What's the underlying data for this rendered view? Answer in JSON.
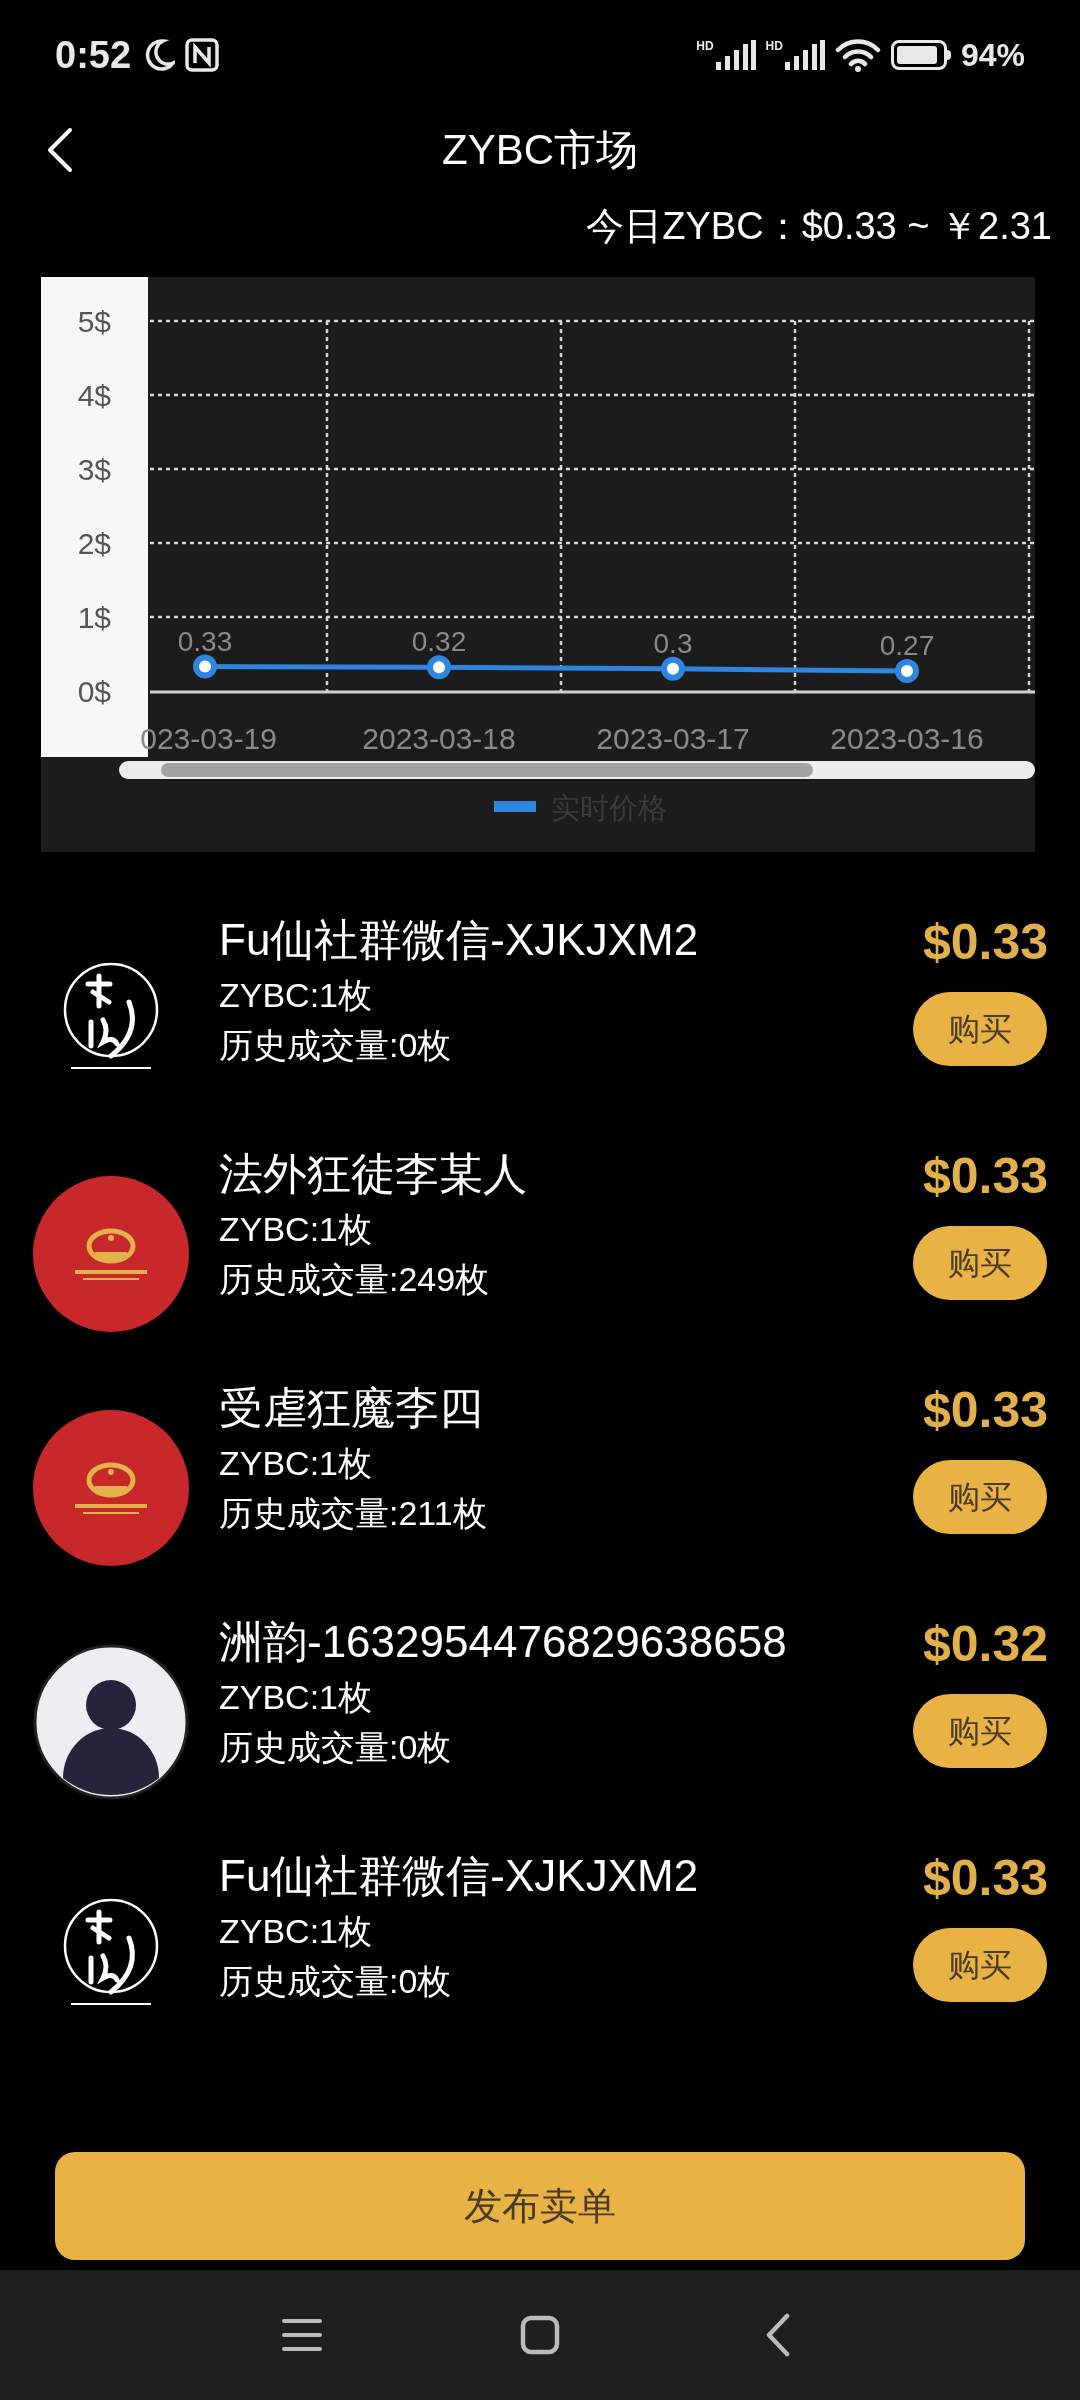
{
  "status_bar": {
    "time": "0:52",
    "signals": [
      {
        "label": "HD"
      },
      {
        "label": "HD"
      }
    ],
    "battery": {
      "text": "94%"
    }
  },
  "header": {
    "title": "ZYBC市场"
  },
  "price_line": "今日ZYBC：$0.33 ~ ￥2.31",
  "chart": {
    "chart_data": {
      "type": "line",
      "categories": [
        "023-03-19",
        "2023-03-18",
        "2023-03-17",
        "2023-03-16"
      ],
      "ylim": [
        0,
        5
      ],
      "yticks": [
        {
          "value": 0,
          "label": "0$"
        },
        {
          "value": 1,
          "label": "1$"
        },
        {
          "value": 2,
          "label": "2$"
        },
        {
          "value": 3,
          "label": "3$"
        },
        {
          "value": 4,
          "label": "4$"
        },
        {
          "value": 5,
          "label": "5$"
        }
      ],
      "series": [
        {
          "name": "实时价格",
          "color": "#2f86e0",
          "values": [
            0.33,
            0.32,
            0.3,
            0.27
          ]
        }
      ],
      "data_labels": true,
      "grid": true,
      "marker": true
    }
  },
  "listings": [
    {
      "avatar": {
        "kind": "logo"
      },
      "name": "Fu仙社群微信-XJKJXM2",
      "quantity": "ZYBC:1枚",
      "history": "历史成交量:0枚",
      "price": "$0.33",
      "button": "购买"
    },
    {
      "avatar": {
        "kind": "emblem"
      },
      "name": "法外狂徒李某人",
      "quantity": "ZYBC:1枚",
      "history": "历史成交量:249枚",
      "price": "$0.33",
      "button": "购买"
    },
    {
      "avatar": {
        "kind": "emblem"
      },
      "name": "受虐狂魔李四",
      "quantity": "ZYBC:1枚",
      "history": "历史成交量:211枚",
      "price": "$0.33",
      "button": "购买"
    },
    {
      "avatar": {
        "kind": "default"
      },
      "name": "洲韵-1632954476829638658",
      "quantity": "ZYBC:1枚",
      "history": "历史成交量:0枚",
      "price": "$0.32",
      "button": "购买"
    },
    {
      "avatar": {
        "kind": "logo"
      },
      "name": "Fu仙社群微信-XJKJXM2",
      "quantity": "ZYBC:1枚",
      "history": "历史成交量:0枚",
      "price": "$0.33",
      "button": "购买"
    }
  ],
  "publish_button": "发布卖单"
}
